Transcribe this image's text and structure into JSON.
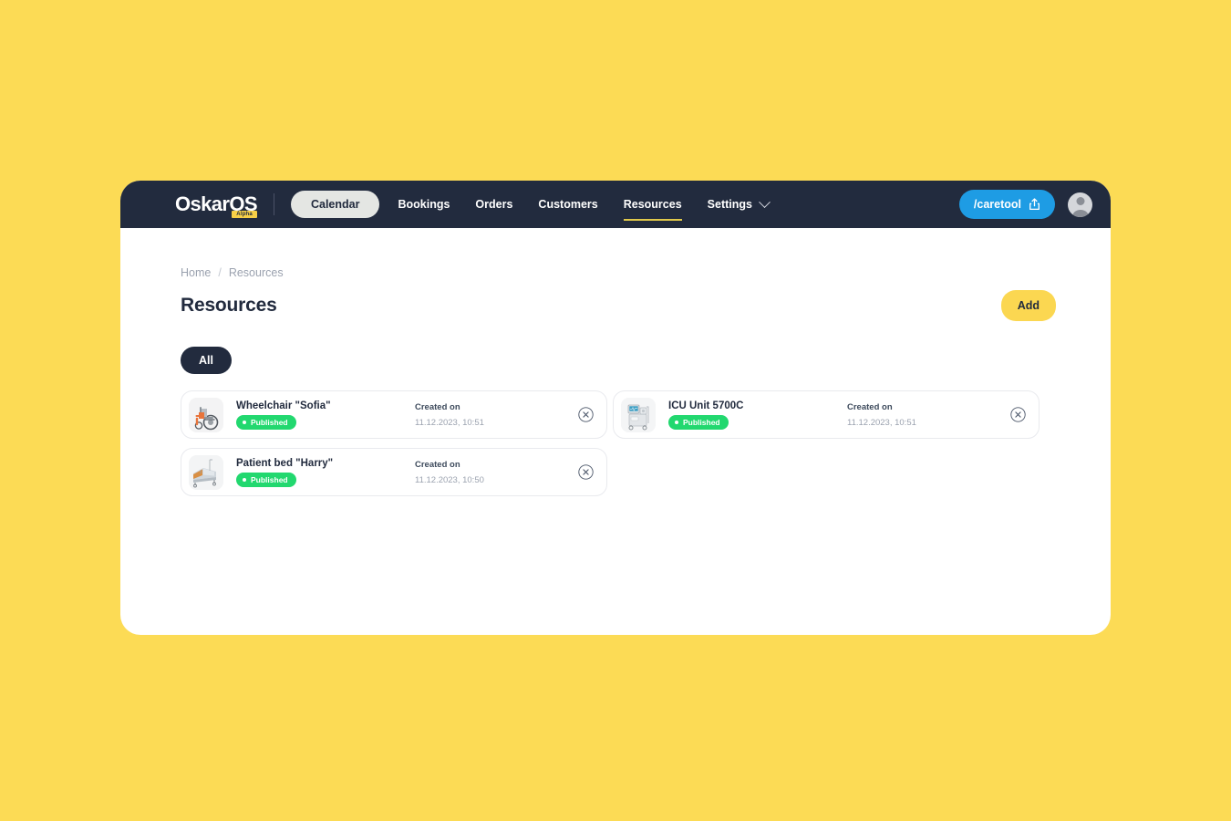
{
  "theme": {
    "page_background": "#fcdb55",
    "navbar_background": "#222b3e",
    "accent_yellow": "#fbd751",
    "accent_blue": "#1e9ce4",
    "status_green": "#22d86f"
  },
  "navbar": {
    "brand": "OskarOS",
    "brand_badge": "Alpha",
    "links": [
      {
        "label": "Calendar",
        "style": "pill",
        "active": false
      },
      {
        "label": "Bookings",
        "style": "plain",
        "active": false
      },
      {
        "label": "Orders",
        "style": "plain",
        "active": false
      },
      {
        "label": "Customers",
        "style": "plain",
        "active": false
      },
      {
        "label": "Resources",
        "style": "plain",
        "active": true
      },
      {
        "label": "Settings",
        "style": "caret",
        "active": false
      }
    ],
    "workspace": {
      "label": "/caretool",
      "icon": "share-icon"
    },
    "avatar_icon": "user-avatar-icon"
  },
  "breadcrumb": {
    "home": "Home",
    "separator": "/",
    "current": "Resources"
  },
  "header": {
    "title": "Resources",
    "add_label": "Add"
  },
  "filters": {
    "chips": [
      {
        "label": "All",
        "selected": true
      }
    ]
  },
  "resources": {
    "meta_label": "Created on",
    "items": [
      {
        "name": "Wheelchair \"Sofia\"",
        "status": "Published",
        "created_label": "Created on",
        "created_value": "11.12.2023, 10:51",
        "thumbnail_icon": "wheelchair-thumbnail",
        "remove_icon": "remove-circle-icon"
      },
      {
        "name": "ICU Unit 5700C",
        "status": "Published",
        "created_label": "Created on",
        "created_value": "11.12.2023, 10:51",
        "thumbnail_icon": "icu-unit-thumbnail",
        "remove_icon": "remove-circle-icon"
      },
      {
        "name": "Patient bed \"Harry\"",
        "status": "Published",
        "created_label": "Created on",
        "created_value": "11.12.2023, 10:50",
        "thumbnail_icon": "patient-bed-thumbnail",
        "remove_icon": "remove-circle-icon"
      }
    ]
  }
}
